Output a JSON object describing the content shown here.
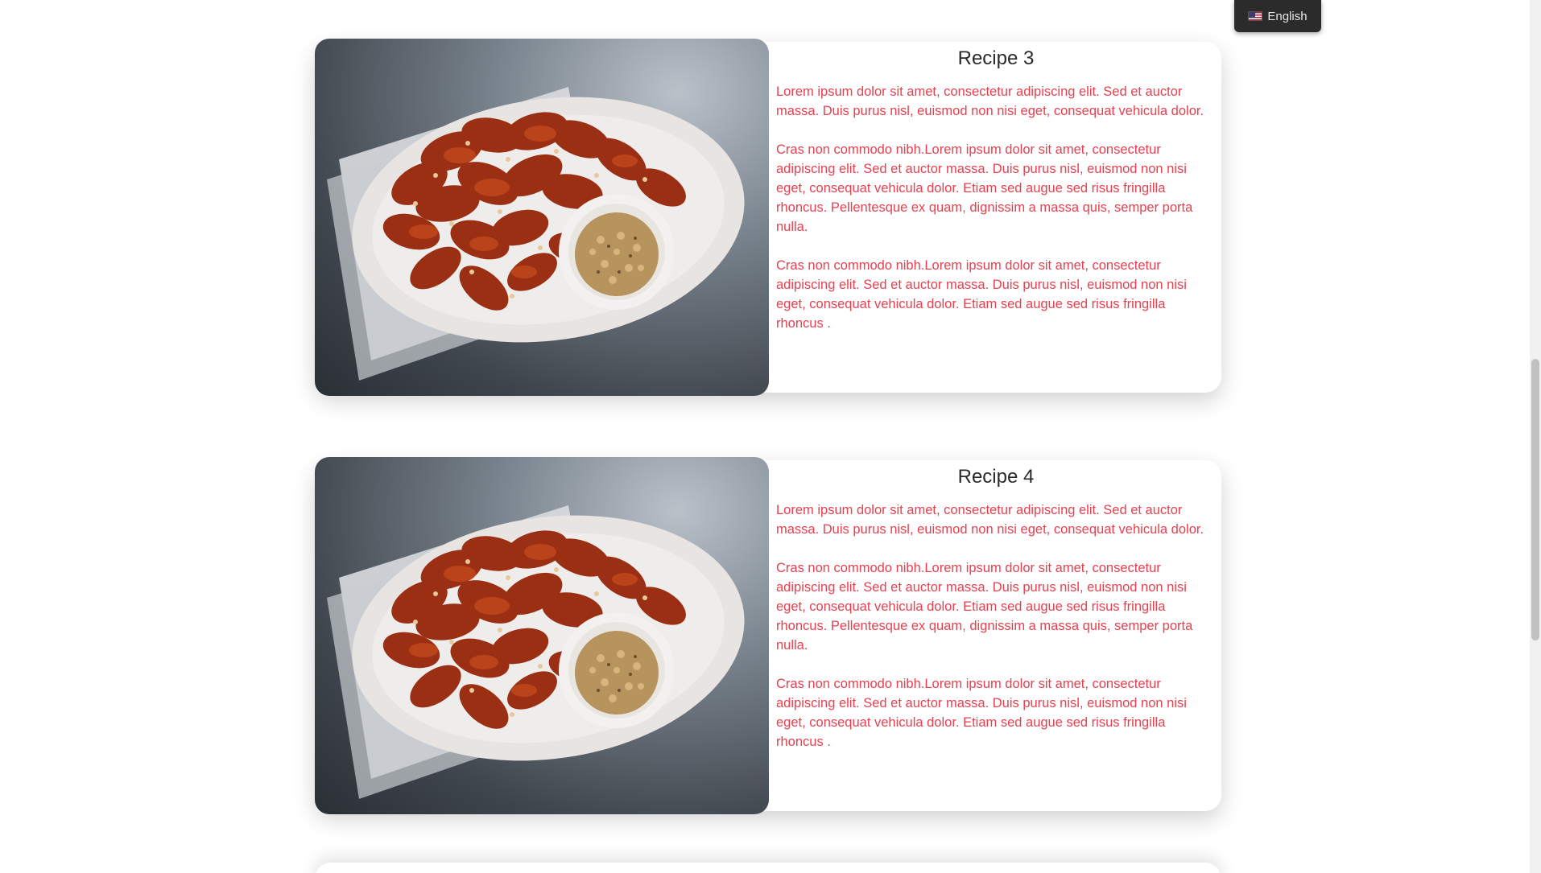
{
  "language_switcher": {
    "label": "English",
    "flag_icon": "us-flag-icon"
  },
  "recipes": [
    {
      "title": "Recipe 3",
      "image_alt": "Plate of glazed chicken wings with a bowl of crushed nuts",
      "paragraphs": [
        "Lorem ipsum dolor sit amet, consectetur adipiscing elit. Sed et auctor massa. Duis purus nisl, euismod non nisi eget, consequat vehicula dolor.",
        "Cras non commodo nibh.Lorem ipsum dolor sit amet, consectetur adipiscing elit. Sed et auctor massa. Duis purus nisl, euismod non nisi eget, consequat vehicula dolor. Etiam sed augue sed risus fringilla rhoncus. Pellentesque ex quam, dignissim a massa quis, semper porta nulla.",
        "Cras non commodo nibh.Lorem ipsum dolor sit amet, consectetur adipiscing elit. Sed et auctor massa. Duis purus nisl, euismod non nisi eget, consequat vehicula dolor. Etiam sed augue sed risus fringilla rhoncus ."
      ]
    },
    {
      "title": "Recipe 4",
      "image_alt": "Plate of glazed chicken wings with a bowl of crushed nuts",
      "paragraphs": [
        "Lorem ipsum dolor sit amet, consectetur adipiscing elit. Sed et auctor massa. Duis purus nisl, euismod non nisi eget, consequat vehicula dolor.",
        "Cras non commodo nibh.Lorem ipsum dolor sit amet, consectetur adipiscing elit. Sed et auctor massa. Duis purus nisl, euismod non nisi eget, consequat vehicula dolor. Etiam sed augue sed risus fringilla rhoncus. Pellentesque ex quam, dignissim a massa quis, semper porta nulla.",
        "Cras non commodo nibh.Lorem ipsum dolor sit amet, consectetur adipiscing elit. Sed et auctor massa. Duis purus nisl, euismod non nisi eget, consequat vehicula dolor. Etiam sed augue sed risus fringilla rhoncus ."
      ]
    }
  ],
  "colors": {
    "paragraph_text": "#e8404f",
    "title_text": "#2a2a2a",
    "switcher_bg": "#2b2b2b"
  }
}
